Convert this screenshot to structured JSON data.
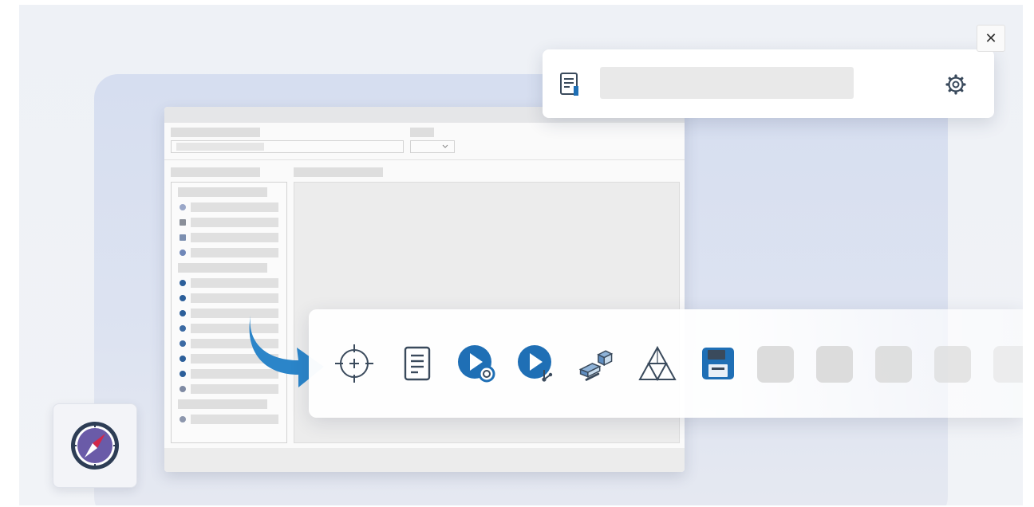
{
  "notification": {
    "field_value": "",
    "icons": [
      "document-icon",
      "gear-icon"
    ]
  },
  "close_button": {
    "icon": "close-icon",
    "glyph": "✕"
  },
  "toolbar": {
    "icons": [
      "crosshair-icon",
      "document-icon",
      "record-icon",
      "video-capture-icon",
      "3d-objects-icon",
      "triangle-mesh-icon",
      "save-icon"
    ],
    "empty_slot_count": 5
  },
  "launcher": {
    "icon": "compass-icon"
  },
  "colors": {
    "accent_blue": "#1f6fb5",
    "arrow_blue": "#2b85c9",
    "icon_dark": "#3a4a5c",
    "compass_red": "#d2284a",
    "compass_purple": "#6a5ba8"
  }
}
